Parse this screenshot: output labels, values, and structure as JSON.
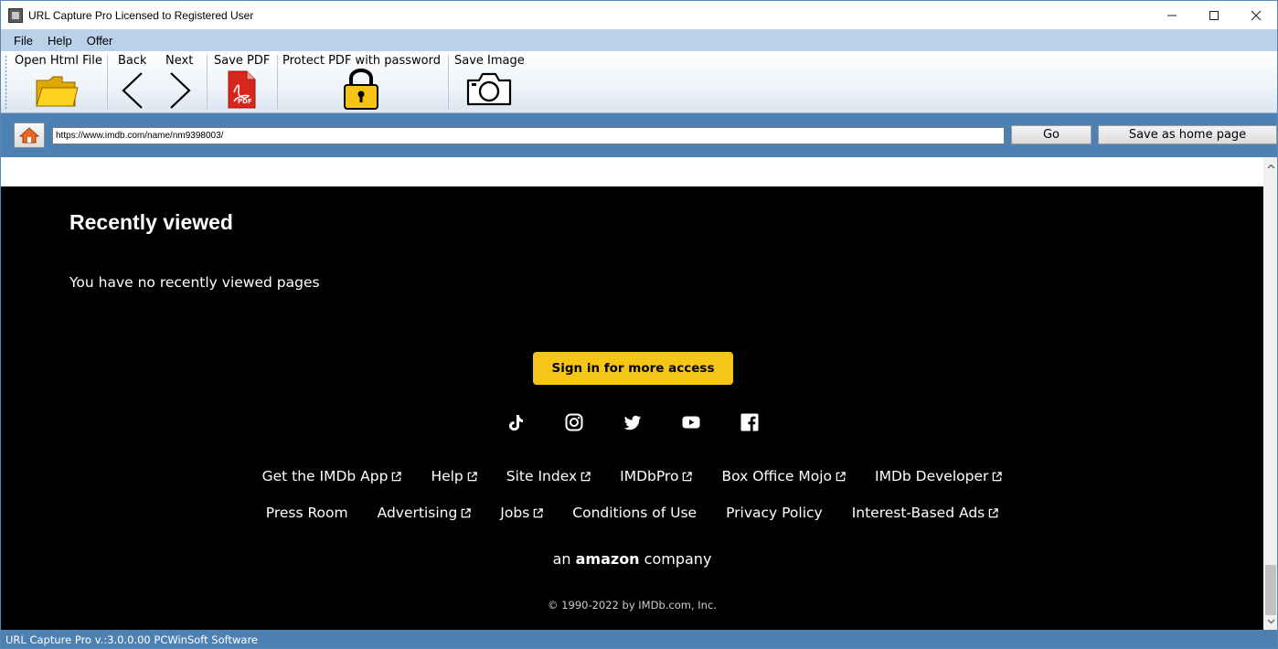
{
  "window": {
    "title": "URL Capture Pro Licensed to Registered User",
    "minimize": "—",
    "maximize": "☐",
    "close": "✕"
  },
  "menu": [
    "File",
    "Help",
    "Offer"
  ],
  "toolbar": {
    "open_html_file": "Open Html File",
    "back": "Back",
    "next": "Next",
    "save_pdf": "Save PDF",
    "protect_pdf": "Protect PDF with password",
    "save_image": "Save Image",
    "pdf_badge": "PDF"
  },
  "address": {
    "url": "https://www.imdb.com/name/nm9398003/",
    "go_label": "Go",
    "save_home_label": "Save as home page"
  },
  "page": {
    "recently_viewed_title": "Recently viewed",
    "recently_viewed_empty": "You have no recently viewed pages",
    "sign_in_button": "Sign in for more access",
    "social_icons": [
      "tiktok-icon",
      "instagram-icon",
      "twitter-icon",
      "youtube-icon",
      "facebook-icon"
    ],
    "footer_links_row1": [
      {
        "label": "Get the IMDb App",
        "external": true
      },
      {
        "label": "Help",
        "external": true
      },
      {
        "label": "Site Index",
        "external": true
      },
      {
        "label": "IMDbPro",
        "external": true
      },
      {
        "label": "Box Office Mojo",
        "external": true
      },
      {
        "label": "IMDb Developer",
        "external": true
      }
    ],
    "footer_links_row2": [
      {
        "label": "Press Room",
        "external": false
      },
      {
        "label": "Advertising",
        "external": true
      },
      {
        "label": "Jobs",
        "external": true
      },
      {
        "label": "Conditions of Use",
        "external": false
      },
      {
        "label": "Privacy Policy",
        "external": false
      },
      {
        "label": "Interest-Based Ads",
        "external": true
      }
    ],
    "amazon_prefix": "an",
    "amazon_brand": "amazon",
    "amazon_suffix": "company",
    "copyright": "© 1990-2022 by IMDb.com, Inc."
  },
  "status": {
    "text": "URL Capture Pro v.:3.0.0.00 PCWinSoft Software"
  },
  "colors": {
    "imdb_yellow": "#f5c518",
    "chrome_blue": "#4d80b3",
    "menu_blue": "#bad1e8"
  }
}
